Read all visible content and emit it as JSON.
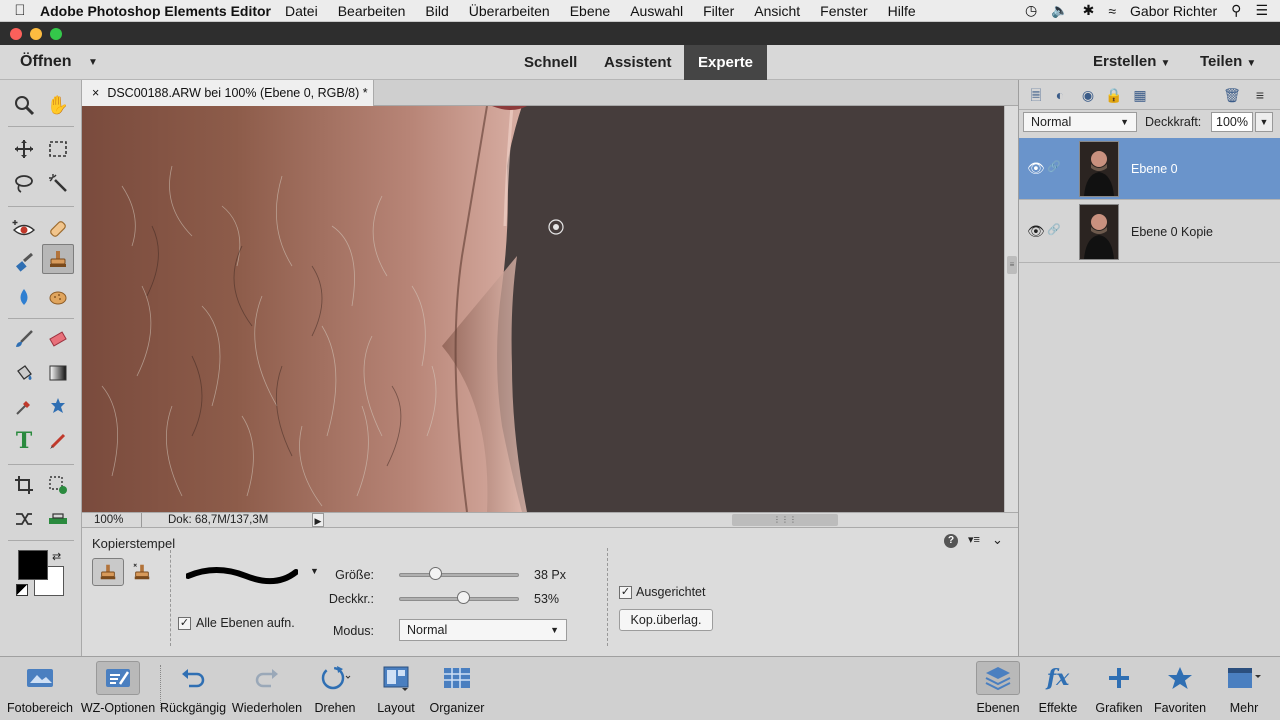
{
  "menubar": {
    "app_name": "Adobe Photoshop Elements Editor",
    "items": [
      "Datei",
      "Bearbeiten",
      "Bild",
      "Überarbeiten",
      "Ebene",
      "Auswahl",
      "Filter",
      "Ansicht",
      "Fenster",
      "Hilfe"
    ],
    "user": "Gabor Richter"
  },
  "modebar": {
    "open_label": "Öffnen",
    "tabs": [
      "Schnell",
      "Assistent",
      "Experte"
    ],
    "active_tab": "Experte",
    "create_label": "Erstellen",
    "share_label": "Teilen"
  },
  "document": {
    "tab_title": "DSC00188.ARW bei 100% (Ebene 0, RGB/8) *",
    "close_glyph": "×",
    "zoom": "100%",
    "doc_info": "Dok: 68,7M/137,3M"
  },
  "tool_options": {
    "title": "Kopierstempel",
    "size_label": "Größe:",
    "size_value": "38 Px",
    "size_fraction": 0.3,
    "opacity_label": "Deckkr.:",
    "opacity_value": "53%",
    "opacity_fraction": 0.53,
    "mode_label": "Modus:",
    "mode_value": "Normal",
    "all_layers_label": "Alle Ebenen aufn.",
    "all_layers_checked": true,
    "aligned_label": "Ausgerichtet",
    "aligned_checked": true,
    "overlay_button": "Kop.überlag."
  },
  "layers_panel": {
    "blend_mode": "Normal",
    "opacity_label": "Deckkraft:",
    "opacity_value": "100%",
    "layers": [
      {
        "name": "Ebene 0",
        "selected": true
      },
      {
        "name": "Ebene 0 Kopie",
        "selected": false
      }
    ]
  },
  "taskbar": {
    "left": [
      "Fotobereich",
      "WZ-Optionen",
      "Rückgängig",
      "Wiederholen",
      "Drehen",
      "Layout",
      "Organizer"
    ],
    "right": [
      "Ebenen",
      "Effekte",
      "Grafiken",
      "Favoriten",
      "Mehr"
    ]
  },
  "colors": {
    "accent_selected_layer": "#6a94cb",
    "active_mode_tab": "#454545",
    "icon_blue": "#3a5b88",
    "foreground_color": "#000000",
    "background_color": "#ffffff"
  }
}
